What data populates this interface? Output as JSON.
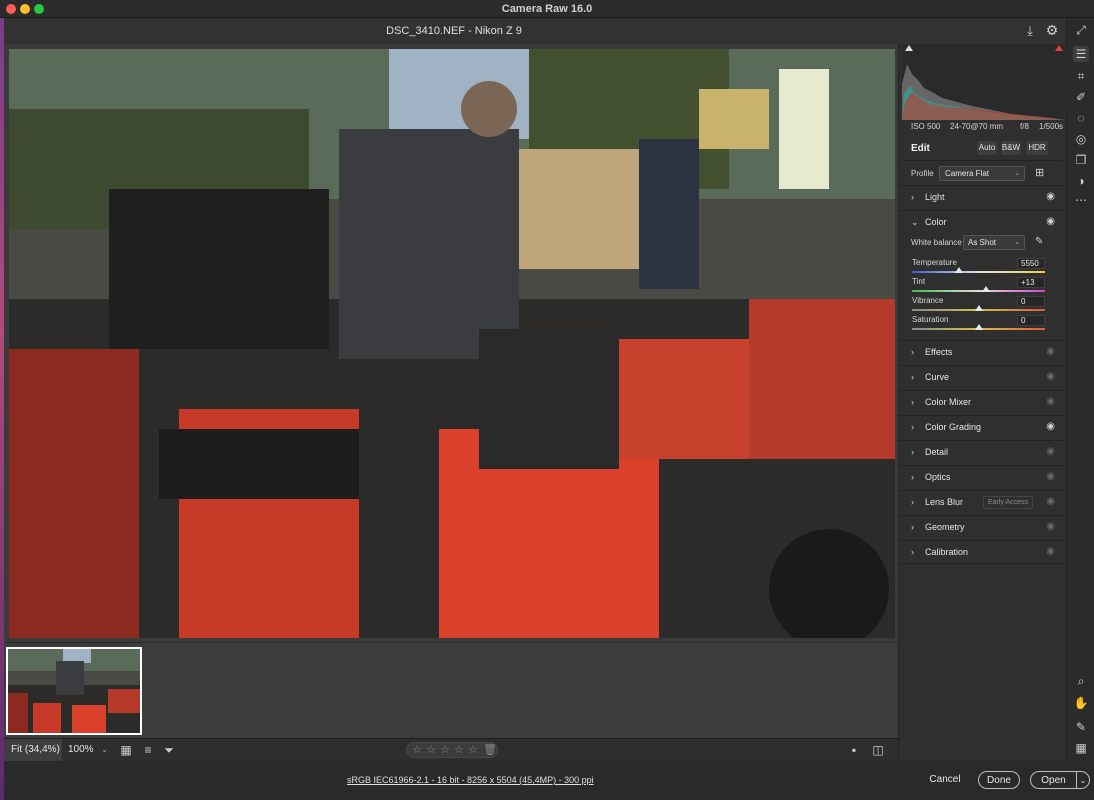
{
  "window": {
    "title": "Camera Raw 16.0"
  },
  "file": {
    "title": "DSC_3410.NEF  -  Nikon Z 9"
  },
  "exif": {
    "iso": "ISO 500",
    "lens": "24-70@70 mm",
    "aperture": "f/8",
    "shutter": "1/500s"
  },
  "edit": {
    "title": "Edit",
    "auto": "Auto",
    "bw": "B&W",
    "hdr": "HDR",
    "profile_label": "Profile",
    "profile_value": "Camera Flat"
  },
  "color": {
    "wb_label": "White balance",
    "wb_value": "As Shot",
    "sliders": [
      {
        "label": "Temperature",
        "value": "5550",
        "position": 0.35
      },
      {
        "label": "Tint",
        "value": "+13",
        "position": 0.56
      },
      {
        "label": "Vibrance",
        "value": "0",
        "position": 0.5
      },
      {
        "label": "Saturation",
        "value": "0",
        "position": 0.5
      }
    ]
  },
  "sections": {
    "light": "Light",
    "color": "Color",
    "effects": "Effects",
    "curve": "Curve",
    "color_mixer": "Color Mixer",
    "color_grading": "Color Grading",
    "detail": "Detail",
    "optics": "Optics",
    "lens_blur": "Lens Blur",
    "lens_blur_badge": "Early Access",
    "geometry": "Geometry",
    "calibration": "Calibration"
  },
  "bottom": {
    "fit": "Fit (34,4%)",
    "zoom": "100%",
    "info": "sRGB IEC61966-2.1 - 16 bit - 8256 x 5504 (45,4MP) - 300 ppi"
  },
  "buttons": {
    "cancel": "Cancel",
    "done": "Done",
    "open": "Open"
  },
  "icons": {
    "save": "save-icon",
    "settings": "gear-icon",
    "expand": "expand-icon",
    "eye": "eye-icon",
    "star": "star-icon",
    "trash": "trash-icon"
  },
  "colors": {
    "accent_red": "#e04040",
    "panel_bg": "#2f2f2f"
  }
}
